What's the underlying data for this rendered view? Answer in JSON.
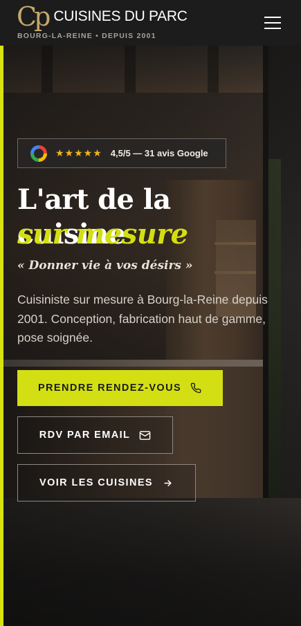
{
  "header": {
    "logo_mark": "Cp",
    "brand_name": "CUISINES DU PARC",
    "tagline": "BOURG-LA-REINE • DEPUIS 2001",
    "menu_icon": "hamburger-menu-icon"
  },
  "rating": {
    "icon": "google-icon",
    "stars": "★★★★★",
    "text": "4,5/5 — 31 avis Google"
  },
  "hero": {
    "title_line1": "L'art de la cuisine",
    "title_line2": "sur mesure",
    "quote": "« Donner vie à vos désirs »",
    "description": "Cuisiniste sur mesure à Bourg-la-Reine depuis 2001. Conception, fabrication haut de gamme, pose soignée."
  },
  "buttons": {
    "primary": {
      "label": "PRENDRE RENDEZ-VOUS",
      "icon": "phone-icon"
    },
    "email": {
      "label": "RDV PAR EMAIL",
      "icon": "mail-icon"
    },
    "cuisines": {
      "label": "VOIR LES CUISINES",
      "icon": "arrow-right-icon"
    }
  },
  "colors": {
    "accent": "#d4df13",
    "header_bg": "#1c1c1c",
    "logo_gold": "#c6a86b",
    "star": "#f2b51a"
  }
}
